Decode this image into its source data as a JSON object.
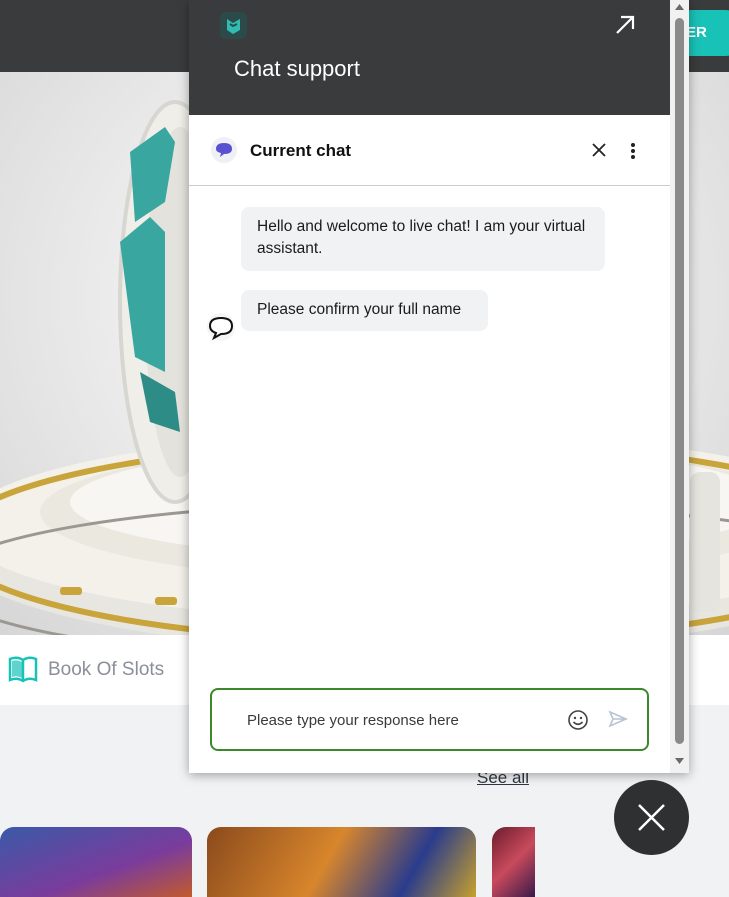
{
  "site": {
    "register_label": "ER",
    "featured_game": "Book Of Slots",
    "see_all_label": "See all"
  },
  "chat": {
    "title": "Chat support",
    "subheader_title": "Current chat",
    "messages": [
      {
        "sender": "assistant",
        "text": "Hello and welcome to live chat! I am your virtual assistant."
      },
      {
        "sender": "assistant",
        "text": "Please confirm your full name"
      }
    ],
    "input_placeholder": "Please type your response here"
  },
  "icons": {
    "logo": "brand-logo-icon",
    "popout": "expand-arrow-icon",
    "bubble": "chat-bubble-icon",
    "close": "close-icon",
    "menu": "kebab-menu-icon",
    "emoji": "emoji-icon",
    "send": "send-icon",
    "book": "book-icon"
  },
  "colors": {
    "header_bg": "#3a3b3c",
    "accent_teal": "#19c2b6",
    "input_border": "#3a8a2c",
    "bubble_purple": "#5a4fd0",
    "message_bg": "#f1f2f4"
  }
}
